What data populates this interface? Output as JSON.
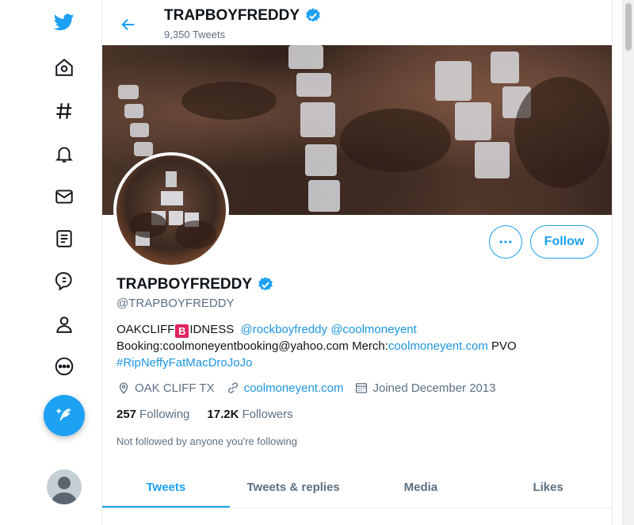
{
  "colors": {
    "accent": "#1da1f2",
    "link": "#1b95e0",
    "muted": "#5b7083",
    "verified": "#1da1f2"
  },
  "sidebar": {
    "items": [
      {
        "icon": "twitter-logo-icon"
      },
      {
        "icon": "home-icon"
      },
      {
        "icon": "hashtag-explore-icon"
      },
      {
        "icon": "bell-notifications-icon"
      },
      {
        "icon": "mail-messages-icon"
      },
      {
        "icon": "list-bookmarks-icon"
      },
      {
        "icon": "lists-icon"
      },
      {
        "icon": "profile-icon"
      },
      {
        "icon": "more-options-icon"
      }
    ],
    "compose_icon": "feather-compose-icon"
  },
  "header": {
    "name": "TRAPBOYFREDDY",
    "tweet_count": "9,350 Tweets"
  },
  "profile": {
    "name": "TRAPBOYFREDDY",
    "handle": "@TRAPBOYFREDDY",
    "bio": {
      "line1_prefix": "OAKCLIFF",
      "line1_badge": "B",
      "line1_suffix": "IDNESS",
      "mention1": "@rockboyfreddy",
      "mention2": "@coolmoneyent",
      "line2_text": "Booking:coolmoneyentbooking@yahoo.com Merch:",
      "line2_link": "coolmoneyent.com",
      "line2_tail": "PVO",
      "hashtag": "#RipNeffyFatMacDroJoJo"
    },
    "location": "OAK CLIFF TX",
    "website": "coolmoneyent.com",
    "joined": "Joined December 2013",
    "following_count": "257",
    "following_label": "Following",
    "followers_count": "17.2K",
    "followers_label": "Followers",
    "not_followed": "Not followed by anyone you're following",
    "follow_label": "Follow"
  },
  "tabs": [
    {
      "label": "Tweets",
      "active": true
    },
    {
      "label": "Tweets & replies",
      "active": false
    },
    {
      "label": "Media",
      "active": false
    },
    {
      "label": "Likes",
      "active": false
    }
  ]
}
